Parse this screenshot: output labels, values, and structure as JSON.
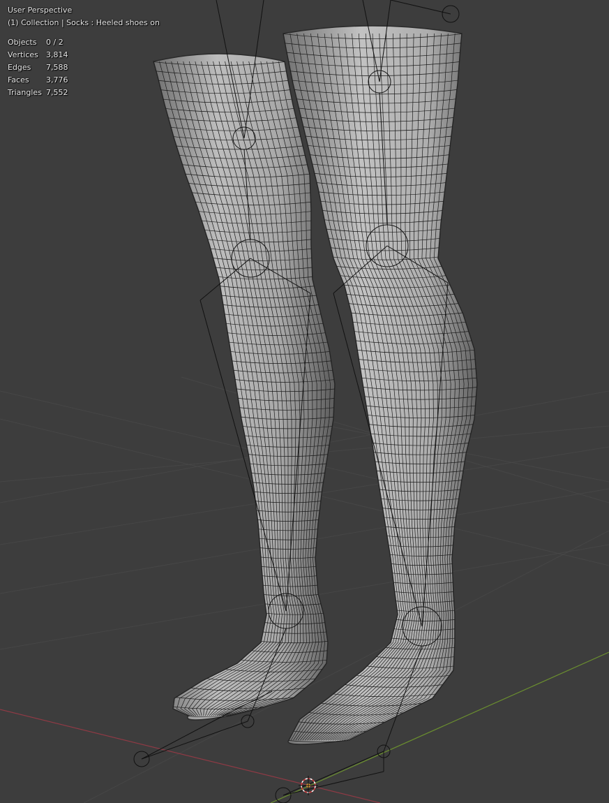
{
  "viewport": {
    "perspective_label": "User Perspective",
    "collection_line": "(1) Collection | Socks : Heeled shoes on",
    "stats": [
      {
        "label": "Objects",
        "value": "0 / 2"
      },
      {
        "label": "Vertices",
        "value": "3,814"
      },
      {
        "label": "Edges",
        "value": "7,588"
      },
      {
        "label": "Faces",
        "value": "3,776"
      },
      {
        "label": "Triangles",
        "value": "7,552"
      }
    ]
  },
  "colors": {
    "background": "#3d3d3d",
    "grid": "#4a4a4a",
    "x_axis": "#8f3a45",
    "y_axis": "#6b8f2f",
    "mesh_fill": "#a9a9a9",
    "wire": "#1a1a1a",
    "armature": "#111111",
    "origin": "#e8a23a"
  }
}
